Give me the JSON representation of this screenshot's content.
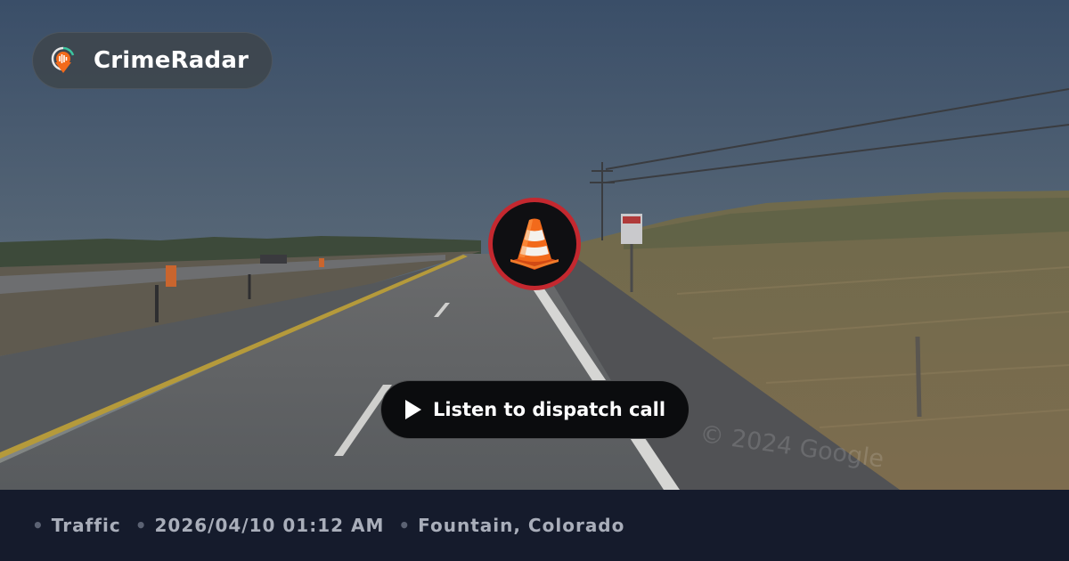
{
  "brand": {
    "name": "CrimeRadar",
    "logo_icon": "radar-pin-icon"
  },
  "incident": {
    "icon": "traffic-cone-icon",
    "badge_color": "#c4282f"
  },
  "listen_button": {
    "label": "Listen to dispatch call",
    "icon": "play-icon"
  },
  "watermark": "© 2024 Google",
  "meta": {
    "category": "Traffic",
    "datetime": "2026/04/10 01:12 AM",
    "location": "Fountain, Colorado"
  },
  "colors": {
    "footer_bg": "#151b2c",
    "meta_text": "#a9aeba",
    "accent_orange": "#f26a1b"
  }
}
